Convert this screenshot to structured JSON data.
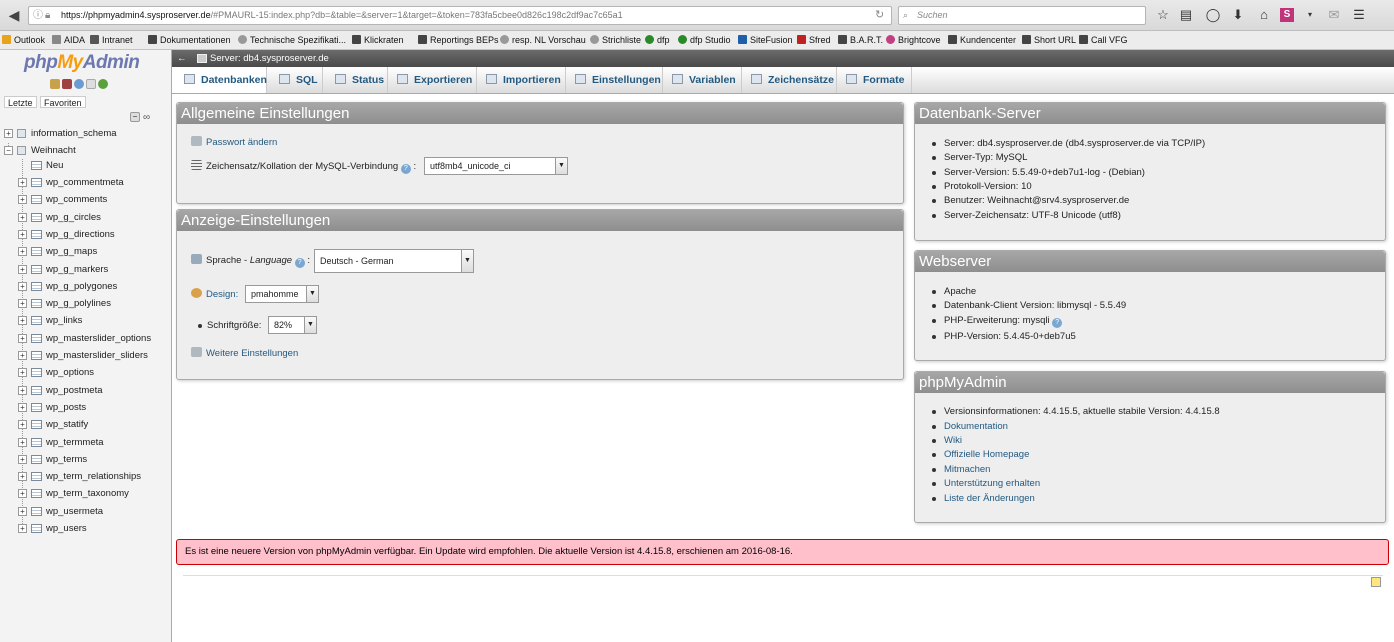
{
  "browser": {
    "url_host": "https://phpmyadmin4.sysproserver.de",
    "url_rest": "/#PMAURL-15:index.php?db=&table=&server=1&target=&token=783fa5cbee0d826c198c2df9ac7c65a1",
    "search_placeholder": "Suchen",
    "bookmarks": [
      "Outlook",
      "AIDA",
      "Intranet",
      "Dokumentationen",
      "Technische Spezifikati...",
      "Klickraten",
      "Reportings BEPs",
      "resp. NL Vorschau",
      "Strichliste",
      "dfp",
      "dfp Studio",
      "SiteFusion",
      "Sfred",
      "B.A.R.T.",
      "Brightcove",
      "Kundencenter",
      "Short URL",
      "Call VFG"
    ]
  },
  "nav": {
    "logo": {
      "php": "php",
      "my": "My",
      "admin": "Admin"
    },
    "tab_recent": "Letzte",
    "tab_favorites": "Favoriten",
    "databases": [
      {
        "name": "information_schema",
        "expanded": false
      },
      {
        "name": "Weihnacht",
        "expanded": true
      }
    ],
    "new_label": "Neu",
    "tables": [
      "wp_commentmeta",
      "wp_comments",
      "wp_g_circles",
      "wp_g_directions",
      "wp_g_maps",
      "wp_g_markers",
      "wp_g_polygones",
      "wp_g_polylines",
      "wp_links",
      "wp_masterslider_options",
      "wp_masterslider_sliders",
      "wp_options",
      "wp_postmeta",
      "wp_posts",
      "wp_statify",
      "wp_termmeta",
      "wp_terms",
      "wp_term_relationships",
      "wp_term_taxonomy",
      "wp_usermeta",
      "wp_users"
    ]
  },
  "topbar": {
    "server_label": "Server: db4.sysproserver.de"
  },
  "tabs": [
    "Datenbanken",
    "SQL",
    "Status",
    "Exportieren",
    "Importieren",
    "Einstellungen",
    "Variablen",
    "Zeichensätze",
    "Formate"
  ],
  "general": {
    "title": "Allgemeine Einstellungen",
    "change_password": "Passwort ändern",
    "collation_label": "Zeichensatz/Kollation der MySQL-Verbindung",
    "collation_value": "utf8mb4_unicode_ci"
  },
  "appearance": {
    "title": "Anzeige-Einstellungen",
    "language_label": "Sprache - ",
    "language_label_italic": "Language",
    "language_value": "Deutsch - German",
    "design_label": "Design:",
    "design_value": "pmahomme",
    "fontsize_label": "Schriftgröße:",
    "fontsize_value": "82%",
    "more_settings": "Weitere Einstellungen"
  },
  "db_server": {
    "title": "Datenbank-Server",
    "items": [
      "Server: db4.sysproserver.de (db4.sysproserver.de via TCP/IP)",
      "Server-Typ: MySQL",
      "Server-Version: 5.5.49-0+deb7u1-log - (Debian)",
      "Protokoll-Version: 10",
      "Benutzer: Weihnacht@srv4.sysproserver.de",
      "Server-Zeichensatz: UTF-8 Unicode (utf8)"
    ]
  },
  "webserver": {
    "title": "Webserver",
    "items": [
      "Apache",
      "Datenbank-Client Version: libmysql - 5.5.49",
      "PHP-Erweiterung: mysqli",
      "PHP-Version: 5.4.45-0+deb7u5"
    ]
  },
  "pma": {
    "title": "phpMyAdmin",
    "version_info": "Versionsinformationen: 4.4.15.5, aktuelle stabile Version: 4.4.15.8",
    "links": [
      "Dokumentation",
      "Wiki",
      "Offizielle Homepage",
      "Mitmachen",
      "Unterstützung erhalten",
      "Liste der Änderungen"
    ]
  },
  "notice": "Es ist eine neuere Version von phpMyAdmin verfügbar. Ein Update wird empfohlen. Die aktuelle Version ist 4.4.15.8, erschienen am 2016-08-16."
}
